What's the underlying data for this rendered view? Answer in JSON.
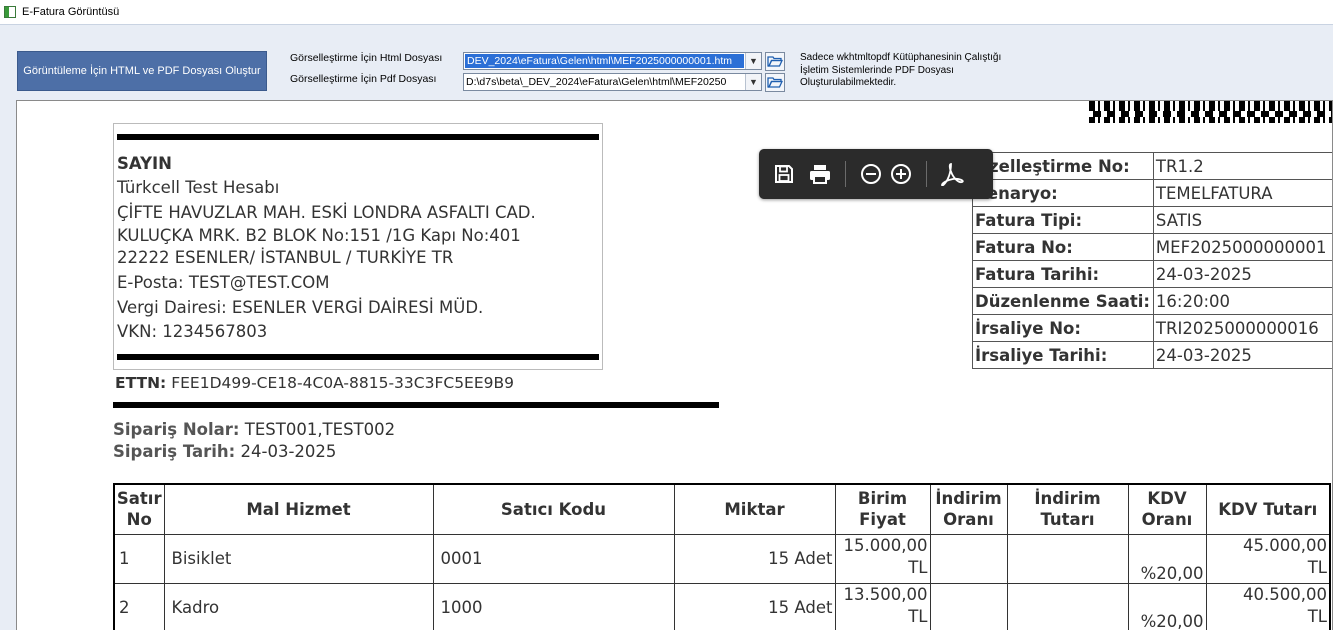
{
  "window": {
    "title": "E-Fatura Görüntüsü"
  },
  "toolbar": {
    "generate_label": "Görüntüleme İçin HTML ve PDF Dosyası Oluştur",
    "html_label": "Görselleştirme İçin Html Dosyası",
    "pdf_label": "Görselleştirme İçin Pdf Dosyası",
    "html_value": "DEV_2024\\eFatura\\Gelen\\html\\MEF2025000000001.htm",
    "pdf_value": "D:\\d7s\\beta\\_DEV_2024\\eFatura\\Gelen\\html\\MEF20250",
    "note_line1": "Sadece wkhtmltopdf Kütüphanesinin Çalıştığı",
    "note_line2": "İşletim Sistemlerinde PDF Dosyası",
    "note_line3": "Oluşturulabilmektedir."
  },
  "pdf_toolbar": {
    "icons": [
      "save-icon",
      "print-icon",
      "zoom-out-icon",
      "zoom-in-icon",
      "acrobat-icon"
    ]
  },
  "invoice": {
    "buyer": {
      "heading": "SAYIN",
      "name": "Türkcell Test Hesabı",
      "address1": "ÇİFTE HAVUZLAR MAH. ESKİ LONDRA ASFALTI CAD.",
      "address2": "KULUÇKA MRK. B2 BLOK  No:151 /1G Kapı No:401",
      "address3": "22222 ESENLER/ İSTANBUL  / TURKİYE TR",
      "email": "E-Posta: TEST@TEST.COM",
      "tax_office": "Vergi Dairesi: ESENLER VERGİ DAİRESİ MÜD.",
      "vkn": "VKN: 1234567803"
    },
    "ettn_label": "ETTN:",
    "ettn_value": "FEE1D499-CE18-4C0A-8815-33C3FC5EE9B9",
    "order_no_label": "Sipariş Nolar:",
    "order_no_value": "TEST001,TEST002",
    "order_date_label": "Sipariş Tarih:",
    "order_date_value": "24-03-2025",
    "meta": [
      {
        "k": "Özelleştirme No:",
        "v": "TR1.2"
      },
      {
        "k": "Senaryo:",
        "v": "TEMELFATURA"
      },
      {
        "k": "Fatura Tipi:",
        "v": "SATIS"
      },
      {
        "k": "Fatura No:",
        "v": "MEF2025000000001"
      },
      {
        "k": "Fatura Tarihi:",
        "v": "24-03-2025"
      },
      {
        "k": "Düzenlenme Saati:",
        "v": "16:20:00"
      },
      {
        "k": "İrsaliye No:",
        "v": "TRI2025000000016"
      },
      {
        "k": "İrsaliye Tarihi:",
        "v": "24-03-2025"
      }
    ],
    "columns": {
      "c0a": "Satır",
      "c0b": "No",
      "c1": "Mal Hizmet",
      "c2": "Satıcı Kodu",
      "c3": "Miktar",
      "c4a": "Birim",
      "c4b": "Fiyat",
      "c5a": "İndirim",
      "c5b": "Oranı",
      "c6a": "İndirim",
      "c6b": "Tutarı",
      "c7a": "KDV",
      "c7b": "Oranı",
      "c8": "KDV Tutarı"
    },
    "rows": [
      {
        "no": "1",
        "item": "Bisiklet",
        "code": "0001",
        "qty": "15 Adet",
        "price1": "15.000,00",
        "price2": "TL",
        "disc_rate": "",
        "disc_amt": "",
        "vat_rate": "%20,00",
        "vat1": "45.000,00",
        "vat2": "TL"
      },
      {
        "no": "2",
        "item": "Kadro",
        "code": "1000",
        "qty": "15 Adet",
        "price1": "13.500,00",
        "price2": "TL",
        "disc_rate": "",
        "disc_amt": "",
        "vat_rate": "%20,00",
        "vat1": "40.500,00",
        "vat2": "TL"
      }
    ]
  }
}
